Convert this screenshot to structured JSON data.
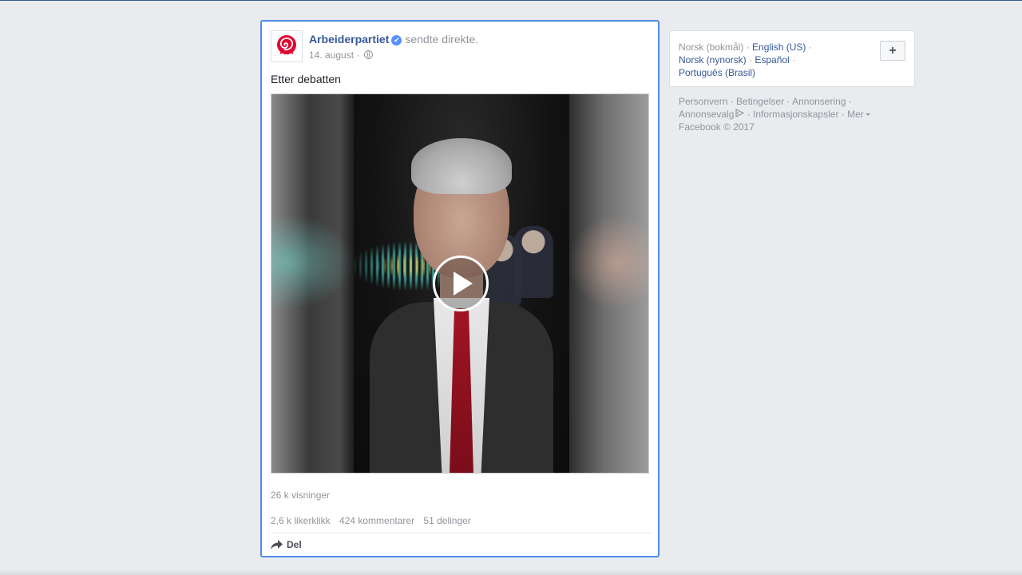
{
  "post": {
    "page_name": "Arbeiderpartiet",
    "action": "sendte direkte.",
    "date": "14. august",
    "date_sep": "·",
    "text": "Etter debatten",
    "views": "26 k visninger",
    "likes": "2,6 k likerklikk",
    "comments": "424 kommentarer",
    "shares": "51 delinger",
    "share_label": "Del",
    "verified_badge": "✔"
  },
  "languages": {
    "current": "Norsk (bokmål)",
    "links": [
      "English (US)",
      "Norsk (nynorsk)",
      "Español",
      "Português (Brasil)"
    ],
    "add_label": "+"
  },
  "footer": {
    "links": [
      "Personvern",
      "Betingelser",
      "Annonsering",
      "Annonsevalg",
      "Informasjonskapsler",
      "Mer"
    ],
    "copyright": "Facebook © 2017"
  },
  "colors": {
    "accent": "#365899",
    "focus_border": "#4d8ce8",
    "background": "#e9ebee",
    "muted_text": "#90949c",
    "logo_red": "#e3032f"
  },
  "icons": {
    "avatar": "rose-logo-icon",
    "verified": "verified-badge-icon",
    "audience": "globe-icon",
    "play": "play-icon",
    "share": "share-arrow-icon",
    "adchoices": "adchoices-icon",
    "more": "caret-down-icon"
  }
}
